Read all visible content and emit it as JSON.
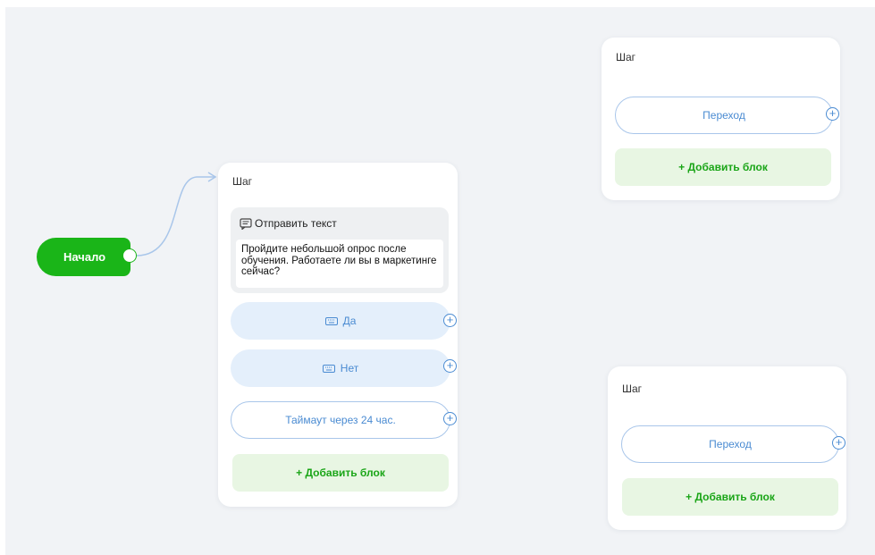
{
  "start": {
    "label": "Начало"
  },
  "step_main": {
    "title": "Шаг",
    "message": {
      "header": "Отправить текст",
      "text": "Пройдите небольшой опрос после обучения. Работаете ли вы в маркетинге сейчас?"
    },
    "buttons": [
      "Да",
      "Нет"
    ],
    "timeout": "Таймаут через 24 час.",
    "add_block": "+ Добавить блок"
  },
  "step_top": {
    "title": "Шаг",
    "transition": "Переход",
    "add_block": "+ Добавить блок"
  },
  "step_bottom": {
    "title": "Шаг",
    "transition": "Переход",
    "add_block": "+ Добавить блок"
  },
  "colors": {
    "start_green": "#1ab518",
    "button_blue_text": "#4a8bd2",
    "button_fill": "#e4effb",
    "add_block_green": "#1aa517",
    "canvas_bg": "#f1f3f6"
  },
  "icons": {
    "message": "message-icon",
    "keyboard": "keyboard-icon",
    "plus": "plus-circle-icon",
    "connector_arrow": "arrow-icon"
  }
}
